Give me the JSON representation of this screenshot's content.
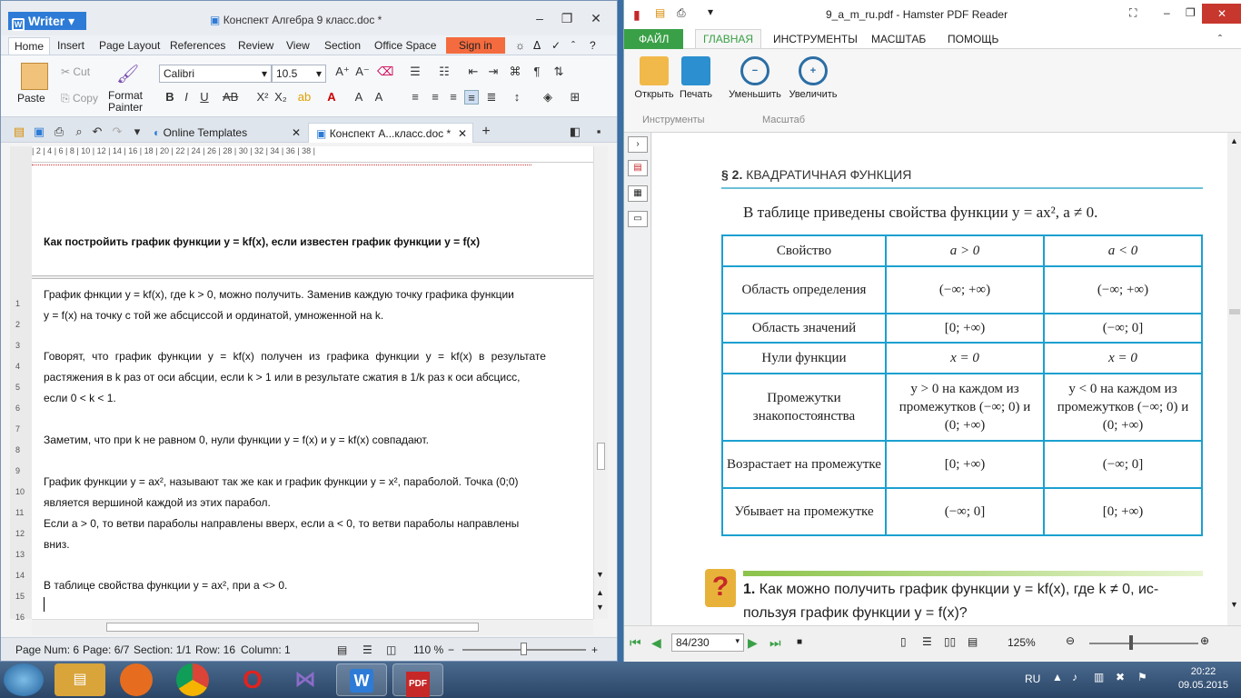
{
  "writer": {
    "app_name": "Writer",
    "doc_title": "Конспект Алгебра 9 класс.doc *",
    "menu": [
      "Home",
      "Insert",
      "Page Layout",
      "References",
      "Review",
      "View",
      "Section",
      "Office Space"
    ],
    "sign_in": "Sign in",
    "ribbon": {
      "paste": "Paste",
      "cut": "Cut",
      "copy": "Copy",
      "format_painter": "Format Painter",
      "font": "Calibri",
      "size": "10.5"
    },
    "tabs": [
      "Online Templates",
      "Конспект А...класс.doc *"
    ],
    "ruler": "| 2 | 4 | 6 | 8 | 10 | 12 | 14 | 16 | 18 | 20 | 22 | 24 | 26 | 28 | 30 | 32 | 34 | 36 | 38 |",
    "vruler": [
      "1",
      "2",
      "3",
      "4",
      "5",
      "6",
      "7",
      "8",
      "9",
      "10",
      "11",
      "12",
      "13",
      "14",
      "15",
      "16"
    ],
    "heading": "Как постройить график функции y = kf(x), если известен график функции y = f(x)",
    "lines": [
      "График фнкции y = kf(x), где k > 0, можно получить. Заменив каждую точку графика функции",
      "y = f(x) на точку с той же абсциссой и ординатой, умноженной на k.",
      "Говорят, что график функции y = kf(x) получен из графика функции y = kf(x) в результате",
      "растяжения в k раз от оси абсции, если k > 1 или в результате сжатия в 1/k раз к оси абсцисс,",
      "если    0 < k < 1.",
      "Заметим, что при k не равном 0, нули функции y = f(x) и y = kf(x) совпадают.",
      "График функции y = ax², называют так же как и график функции y = x², параболой. Точка (0;0)",
      "является вершиной каждой из этих парабол.",
      "Если a > 0, то ветви параболы направлены вверх, если a < 0, то ветви параболы направлены",
      "вниз.",
      "В таблице свойства функции y = ax², при a <> 0."
    ],
    "status": {
      "page_num": "Page Num: 6",
      "page": "Page: 6/7",
      "section": "Section: 1/1",
      "row": "Row: 16",
      "column": "Column: 1",
      "zoom": "110 %"
    }
  },
  "pdf": {
    "title": "9_a_m_ru.pdf - Hamster PDF Reader",
    "tabs": [
      "ФАЙЛ",
      "ГЛАВНАЯ",
      "ИНСТРУМЕНТЫ",
      "МАСШТАБ",
      "ПОМОЩЬ"
    ],
    "buttons": {
      "open": "Открыть",
      "print": "Печать",
      "zoom_out": "Уменьшить",
      "zoom_in": "Увеличить"
    },
    "groups": {
      "tools": "Инструменты",
      "scale": "Масштаб"
    },
    "heading_num": "§ 2.",
    "heading_text": "КВАДРАТИЧНАЯ ФУНКЦИЯ",
    "intro": "В таблице приведены свойства функции y = ax², a ≠ 0.",
    "table": {
      "header": [
        "Свойство",
        "a > 0",
        "a < 0"
      ],
      "rows": [
        [
          "Область определения",
          "(−∞; +∞)",
          "(−∞; +∞)"
        ],
        [
          "Область значений",
          "[0; +∞)",
          "(−∞; 0]"
        ],
        [
          "Нули функции",
          "x = 0",
          "x = 0"
        ],
        [
          "Промежутки знакопостоянства",
          "y > 0 на каждом из промежутков (−∞; 0) и (0; +∞)",
          "y < 0 на каждом из промежутков (−∞; 0) и (0; +∞)"
        ],
        [
          "Возрастает на промежутке",
          "[0; +∞)",
          "(−∞; 0]"
        ],
        [
          "Убывает на промежутке",
          "(−∞; 0]",
          "[0; +∞)"
        ]
      ]
    },
    "question_num": "1.",
    "question": "Как можно получить график функции y = kf(x), где k ≠ 0, ис-",
    "question2": "пользуя график функции y = f(x)?",
    "page_box": "84/230",
    "zoom": "125%"
  },
  "taskbar": {
    "lang": "RU",
    "time": "20:22",
    "date": "09.05.2015"
  },
  "colors": {
    "wps_blue": "#2d7bd6",
    "pdf_green": "#3aa047",
    "table_border": "#1ba0d0"
  }
}
